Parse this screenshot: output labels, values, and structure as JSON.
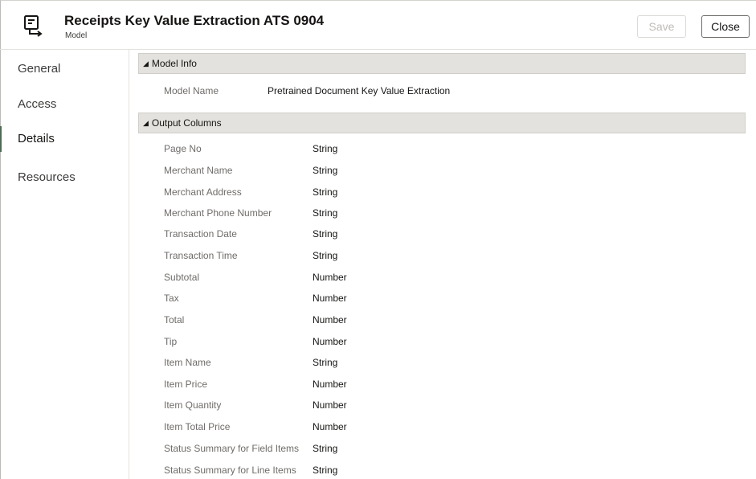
{
  "header": {
    "title": "Receipts Key Value Extraction ATS 0904",
    "subtitle": "Model",
    "save_label": "Save",
    "close_label": "Close",
    "icon": "model-document-icon"
  },
  "sidebar": {
    "items": [
      {
        "label": "General",
        "active": false
      },
      {
        "label": "Access",
        "active": false
      },
      {
        "label": "Details",
        "active": true
      },
      {
        "label": "Resources",
        "active": false
      }
    ]
  },
  "model_info": {
    "section_title": "Model Info",
    "model_name_label": "Model Name",
    "model_name_value": "Pretrained Document Key Value Extraction"
  },
  "output_columns": {
    "section_title": "Output Columns",
    "rows": [
      {
        "name": "Page No",
        "type": "String"
      },
      {
        "name": "Merchant Name",
        "type": "String"
      },
      {
        "name": "Merchant Address",
        "type": "String"
      },
      {
        "name": "Merchant Phone Number",
        "type": "String"
      },
      {
        "name": "Transaction Date",
        "type": "String"
      },
      {
        "name": "Transaction Time",
        "type": "String"
      },
      {
        "name": "Subtotal",
        "type": "Number"
      },
      {
        "name": "Tax",
        "type": "Number"
      },
      {
        "name": "Total",
        "type": "Number"
      },
      {
        "name": "Tip",
        "type": "Number"
      },
      {
        "name": "Item Name",
        "type": "String"
      },
      {
        "name": "Item Price",
        "type": "Number"
      },
      {
        "name": "Item Quantity",
        "type": "Number"
      },
      {
        "name": "Item Total Price",
        "type": "Number"
      },
      {
        "name": "Status Summary for Field Items",
        "type": "String"
      },
      {
        "name": "Status Summary for Line Items",
        "type": "String"
      }
    ]
  },
  "colors": {
    "accent": "#4e6b53",
    "section_bg": "#e4e2de",
    "label": "#6f6c69"
  }
}
